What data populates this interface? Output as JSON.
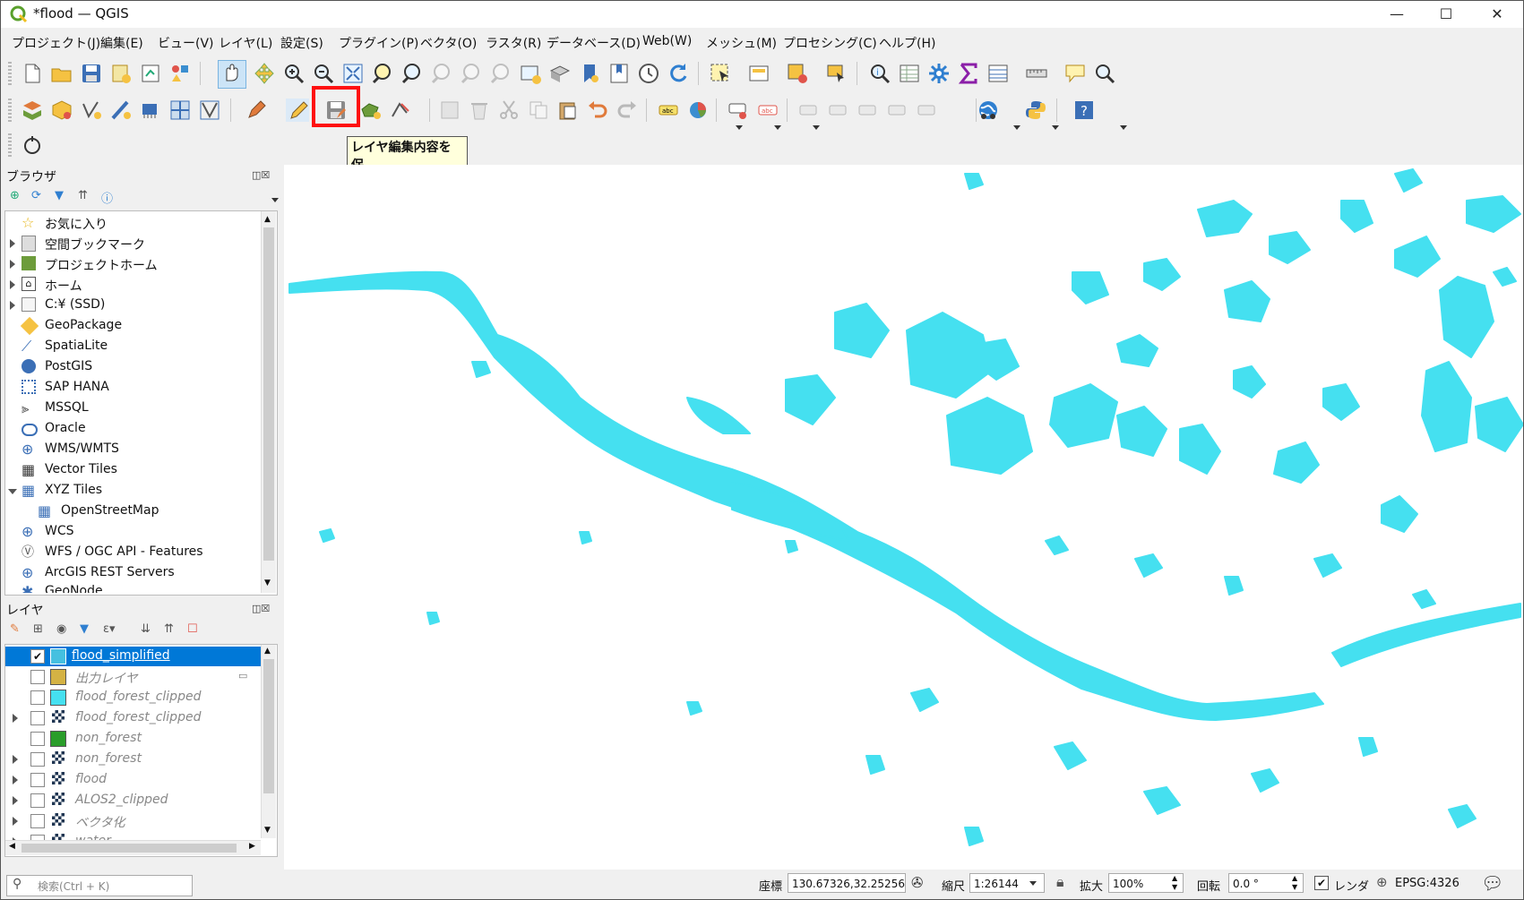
{
  "window": {
    "title": "*flood — QGIS",
    "minimize": "—",
    "maximize": "☐",
    "close": "✕"
  },
  "menu": [
    "プロジェクト(J)",
    "編集(E)",
    "ビュー(V)",
    "レイヤ(L)",
    "設定(S)",
    "プラグイン(P)",
    "ベクタ(O)",
    "ラスタ(R)",
    "データベース(D)",
    "Web(W)",
    "メッシュ(M)",
    "プロセシング(C)",
    "ヘルプ(H)"
  ],
  "tooltip": {
    "line1": "レイヤ編集内容を保",
    "line2": "存"
  },
  "browser": {
    "title": "ブラウザ",
    "items": [
      {
        "label": "お気に入り",
        "icon": "star-icon"
      },
      {
        "label": "空間ブックマーク",
        "icon": "bookmark-icon"
      },
      {
        "label": "プロジェクトホーム",
        "icon": "project-home-icon"
      },
      {
        "label": "ホーム",
        "icon": "home-folder-icon"
      },
      {
        "label": "C:¥ (SSD)",
        "icon": "drive-icon"
      },
      {
        "label": "GeoPackage",
        "icon": "geopackage-icon"
      },
      {
        "label": "SpatiaLite",
        "icon": "spatialite-icon"
      },
      {
        "label": "PostGIS",
        "icon": "postgis-icon"
      },
      {
        "label": "SAP HANA",
        "icon": "sap-hana-icon"
      },
      {
        "label": "MSSQL",
        "icon": "mssql-icon"
      },
      {
        "label": "Oracle",
        "icon": "oracle-icon"
      },
      {
        "label": "WMS/WMTS",
        "icon": "wms-icon"
      },
      {
        "label": "Vector Tiles",
        "icon": "vector-tiles-icon"
      },
      {
        "label": "XYZ Tiles",
        "icon": "xyz-tiles-icon"
      },
      {
        "label": "OpenStreetMap",
        "icon": "osm-icon"
      },
      {
        "label": "WCS",
        "icon": "wcs-icon"
      },
      {
        "label": "WFS / OGC API - Features",
        "icon": "wfs-icon"
      },
      {
        "label": "ArcGIS REST Servers",
        "icon": "arcgis-icon"
      },
      {
        "label": "GeoNode",
        "icon": "geonode-icon"
      }
    ]
  },
  "layers": {
    "title": "レイヤ",
    "items": [
      {
        "label": "flood_simplified",
        "checked": true,
        "selected": true,
        "icon": "editing-pencil-icon"
      },
      {
        "label": "出力レイヤ",
        "checked": false,
        "icon": "polygon-symbol-icon",
        "color": "#d4b244"
      },
      {
        "label": "flood_forest_clipped",
        "checked": false,
        "icon": "polygon-symbol-icon",
        "color": "#45e0f0"
      },
      {
        "label": "flood_forest_clipped",
        "checked": false,
        "icon": "raster-icon"
      },
      {
        "label": "non_forest",
        "checked": false,
        "icon": "polygon-symbol-icon",
        "color": "#2a9d2a"
      },
      {
        "label": "non_forest",
        "checked": false,
        "icon": "raster-icon"
      },
      {
        "label": "flood",
        "checked": false,
        "icon": "raster-icon"
      },
      {
        "label": "ALOS2_clipped",
        "checked": false,
        "icon": "raster-icon"
      },
      {
        "label": "ベクタ化",
        "checked": false,
        "icon": "raster-icon"
      },
      {
        "label": "water",
        "checked": false,
        "icon": "raster-icon"
      }
    ]
  },
  "status": {
    "search_placeholder": "検索(Ctrl + K)",
    "coord_label": "座標",
    "coord_value": "130.67326,32.25256",
    "scale_label": "縮尺",
    "scale_value": "1:26144",
    "magnifier_label": "拡大",
    "magnifier_value": "100%",
    "rotation_label": "回転",
    "rotation_value": "0.0 °",
    "render_label": "レンダ",
    "crs": "EPSG:4326"
  },
  "colors": {
    "flood_fill": "#45e0f0",
    "highlight": "#ff1010",
    "tooltip_bg": "#ffffdc",
    "selected_row": "#0078d7"
  }
}
